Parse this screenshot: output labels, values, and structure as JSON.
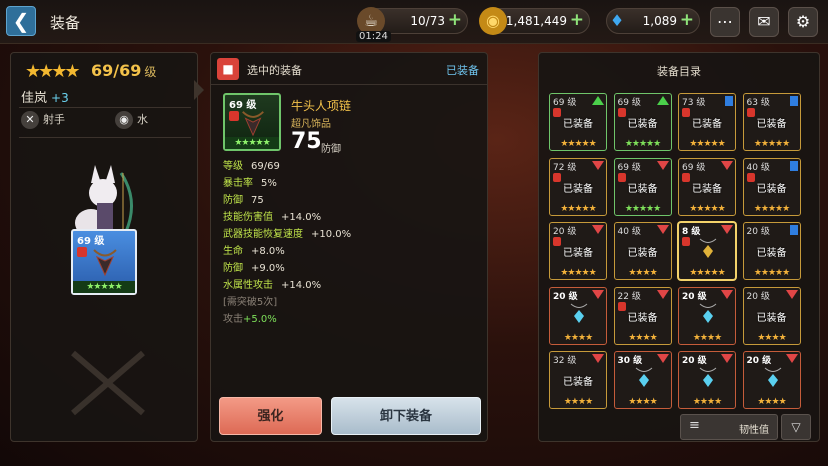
{
  "header": {
    "back_icon": "back-arrow-icon",
    "title": "装备",
    "stamina": {
      "value": "10/73",
      "timer": "01:24",
      "icon": "coffee-cup-icon"
    },
    "gold": {
      "value": "1,481,449",
      "icon": "coin-icon"
    },
    "gems": {
      "value": "1,089",
      "icon": "diamond-icon"
    },
    "plus": "+",
    "icons": [
      "chat-bubble-icon",
      "mail-icon",
      "gear-icon"
    ]
  },
  "hero": {
    "stars": "★★★★",
    "level": "69/69",
    "level_unit": "级",
    "name": "佳岚",
    "bonus": "+3",
    "class": "射手",
    "element": "水",
    "slot": {
      "level": "69 级",
      "stars": "★★★★★"
    }
  },
  "selected": {
    "header": "选中的装备",
    "status": "已装备",
    "level": "69 级",
    "name": "牛头人项链",
    "rarity": "超凡饰品",
    "defense_value": "75",
    "defense_label": "防御",
    "item_stars": "★★★★★",
    "stats": [
      {
        "label": "等级",
        "value": "69/69"
      },
      {
        "label": "暴击率",
        "value": "5%"
      },
      {
        "label": "防御",
        "value": "75"
      },
      {
        "label": "技能伤害值",
        "value": "+14.0%"
      },
      {
        "label": "武器技能恢复速度",
        "value": "+10.0%"
      },
      {
        "label": "生命",
        "value": "+8.0%"
      },
      {
        "label": "防御",
        "value": "+9.0%"
      },
      {
        "label": "水属性攻击",
        "value": "+14.0%"
      }
    ],
    "note": "[需突破5次]",
    "ref_label": "攻击",
    "ref_value": "+5.0%"
  },
  "actions": {
    "enhance": "强化",
    "unequip": "卸下装备"
  },
  "catalog": {
    "title": "装备目录",
    "equipped_label": "已装备",
    "items": [
      {
        "level": "69 级",
        "mark": "up",
        "lock": true,
        "equipped": true,
        "stars": "★★★★★",
        "tone": "green",
        "star_color": "gold"
      },
      {
        "level": "69 级",
        "mark": "up",
        "lock": true,
        "equipped": true,
        "stars": "★★★★★",
        "tone": "green",
        "star_color": "green"
      },
      {
        "level": "73 级",
        "mark": "flag",
        "lock": true,
        "equipped": true,
        "stars": "★★★★★",
        "tone": "gold",
        "star_color": "gold"
      },
      {
        "level": "63 级",
        "mark": "flag",
        "lock": true,
        "equipped": true,
        "stars": "★★★★★",
        "tone": "gold",
        "star_color": "gold"
      },
      {
        "level": "72 级",
        "mark": "down",
        "lock": true,
        "equipped": true,
        "stars": "★★★★★",
        "tone": "gold",
        "star_color": "gold"
      },
      {
        "level": "69 级",
        "mark": "down",
        "lock": true,
        "equipped": true,
        "stars": "★★★★★",
        "tone": "green",
        "star_color": "green"
      },
      {
        "level": "69 级",
        "mark": "down",
        "lock": true,
        "equipped": true,
        "stars": "★★★★★",
        "tone": "gold",
        "star_color": "gold"
      },
      {
        "level": "40 级",
        "mark": "flag",
        "lock": true,
        "equipped": true,
        "stars": "★★★★★",
        "tone": "gold",
        "star_color": "gold"
      },
      {
        "level": "20 级",
        "mark": "down",
        "lock": true,
        "equipped": true,
        "stars": "★★★★★",
        "tone": "gold",
        "star_color": "gold"
      },
      {
        "level": "40 级",
        "mark": "down",
        "lock": false,
        "equipped": true,
        "stars": "★★★★",
        "tone": "gold",
        "star_color": "gold"
      },
      {
        "level": "8 级",
        "mark": "down",
        "lock": true,
        "equipped": false,
        "stars": "★★★★★",
        "tone": "sel",
        "star_color": "gold"
      },
      {
        "level": "20 级",
        "mark": "flag",
        "lock": false,
        "equipped": true,
        "stars": "★★★★★",
        "tone": "gold",
        "star_color": "gold"
      },
      {
        "level": "20 级",
        "mark": "down",
        "lock": false,
        "equipped": false,
        "stars": "★★★★",
        "tone": "orange",
        "star_color": "gold"
      },
      {
        "level": "22 级",
        "mark": "down",
        "lock": true,
        "equipped": true,
        "stars": "★★★★",
        "tone": "gold",
        "star_color": "gold"
      },
      {
        "level": "20 级",
        "mark": "down",
        "lock": false,
        "equipped": false,
        "stars": "★★★★",
        "tone": "orange",
        "star_color": "gold"
      },
      {
        "level": "20 级",
        "mark": "down",
        "lock": false,
        "equipped": true,
        "stars": "★★★★",
        "tone": "gold",
        "star_color": "gold"
      },
      {
        "level": "32 级",
        "mark": "down",
        "lock": false,
        "equipped": true,
        "stars": "★★★★",
        "tone": "gold",
        "star_color": "gold"
      },
      {
        "level": "30 级",
        "mark": "down",
        "lock": false,
        "equipped": false,
        "stars": "★★★★",
        "tone": "orange",
        "star_color": "gold"
      },
      {
        "level": "20 级",
        "mark": "down",
        "lock": false,
        "equipped": false,
        "stars": "★★★★",
        "tone": "orange",
        "star_color": "gold"
      },
      {
        "level": "20 级",
        "mark": "down",
        "lock": false,
        "equipped": false,
        "stars": "★★★★",
        "tone": "orange",
        "star_color": "gold"
      }
    ]
  },
  "filter": {
    "menu_icon": "menu-lines-icon",
    "label": "韧性值",
    "sort_icon": "triangle-down-icon"
  }
}
